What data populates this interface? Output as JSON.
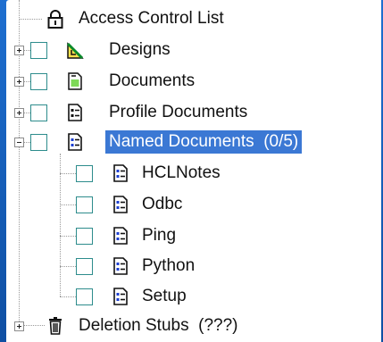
{
  "tree": {
    "acl": {
      "label": "Access Control List",
      "icon": "lock-icon"
    },
    "designs": {
      "label": "Designs",
      "icon": "design-icon"
    },
    "documents": {
      "label": "Documents",
      "icon": "documents-icon"
    },
    "profile_documents": {
      "label": "Profile Documents",
      "icon": "profile-document-icon"
    },
    "named_documents": {
      "label": "Named Documents",
      "count": "(0/5)",
      "selected": true,
      "children": [
        {
          "label": "HCLNotes"
        },
        {
          "label": "Odbc"
        },
        {
          "label": "Ping"
        },
        {
          "label": "Python"
        },
        {
          "label": "Setup"
        }
      ]
    },
    "deletion_stubs": {
      "label": "Deletion Stubs",
      "count": "(???)",
      "icon": "trash-icon"
    }
  },
  "colors": {
    "selection": "#3b78d4",
    "checkbox_border": "#2d8c8c",
    "frame": "#1565c0"
  }
}
